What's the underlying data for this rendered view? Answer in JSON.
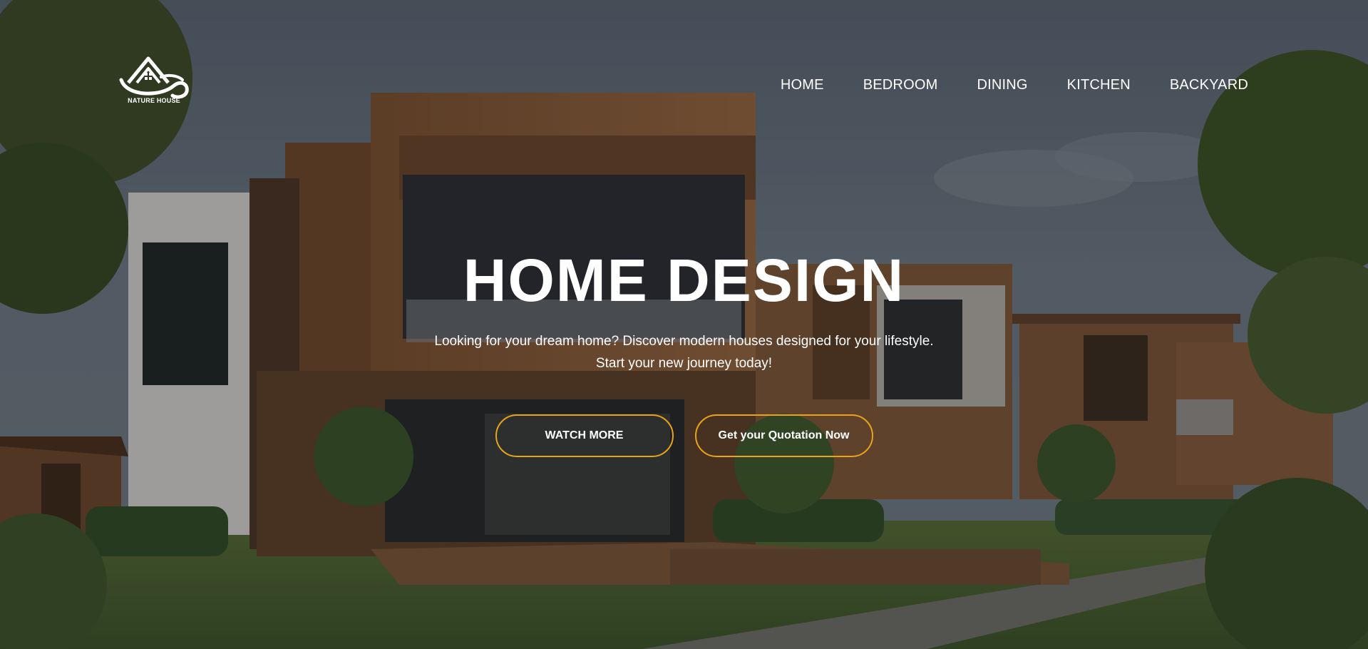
{
  "logo": {
    "text": "NATURE HOUSE",
    "icon": "house-mountain-wave-icon"
  },
  "nav": {
    "items": [
      {
        "label": "HOME"
      },
      {
        "label": "BEDROOM"
      },
      {
        "label": "DINING"
      },
      {
        "label": "KITCHEN"
      },
      {
        "label": "BACKYARD"
      }
    ]
  },
  "hero": {
    "title": "HOME DESIGN",
    "line1": "Looking for your dream home? Discover modern houses designed for your lifestyle.",
    "line2": "Start your new journey today!",
    "watch_label": "WATCH MORE",
    "quote_label": "Get your Quotation Now"
  },
  "colors": {
    "accent": "#e8a317",
    "text": "#ffffff",
    "wood": "#8a5a34",
    "sky": "#5f6a76"
  }
}
